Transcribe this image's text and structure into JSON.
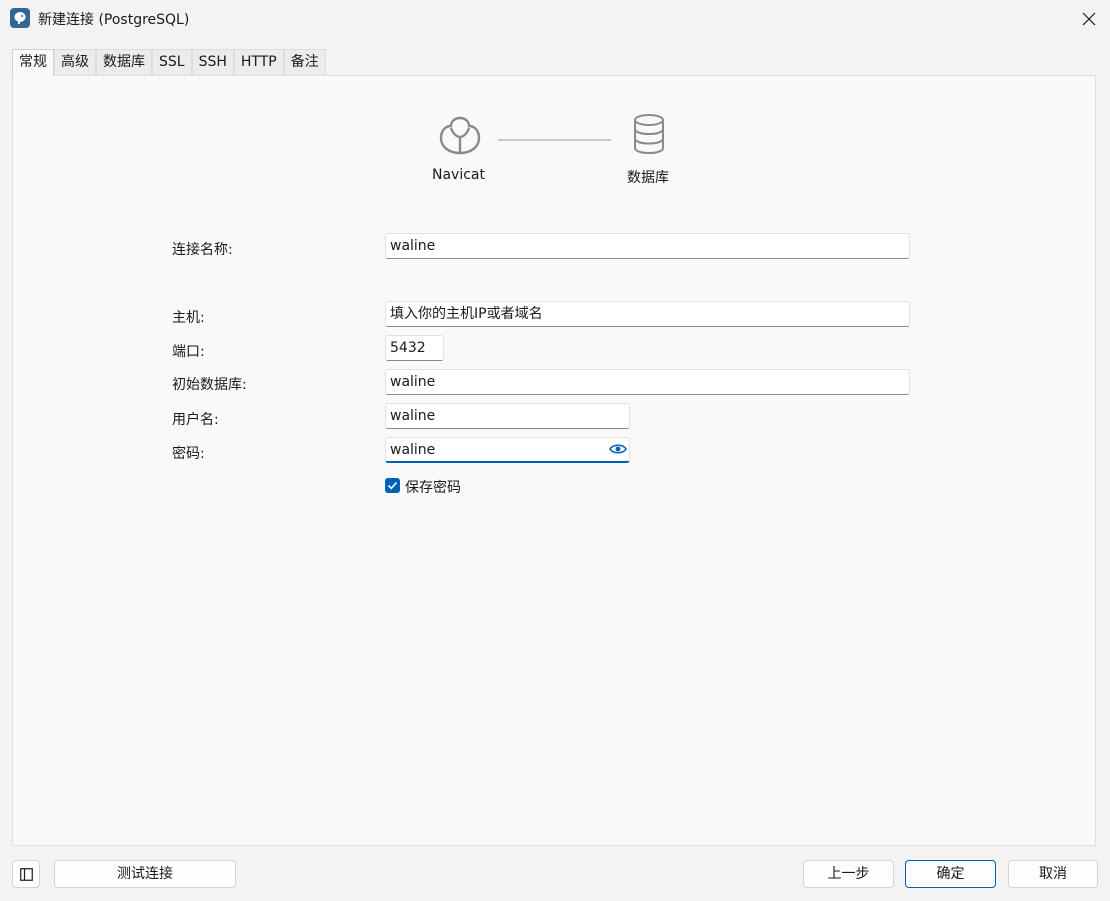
{
  "window": {
    "title": "新建连接 (PostgreSQL)",
    "app_icon": "postgresql-elephant-icon",
    "close_icon": "close-icon"
  },
  "tabs": [
    {
      "label": "常规",
      "active": true
    },
    {
      "label": "高级",
      "active": false
    },
    {
      "label": "数据库",
      "active": false
    },
    {
      "label": "SSL",
      "active": false
    },
    {
      "label": "SSH",
      "active": false
    },
    {
      "label": "HTTP",
      "active": false
    },
    {
      "label": "备注",
      "active": false
    }
  ],
  "diagram": {
    "left_label": "Navicat",
    "right_label": "数据库",
    "left_icon": "navicat-logo-icon",
    "right_icon": "database-icon"
  },
  "form": {
    "connection_name": {
      "label": "连接名称:",
      "value": "waline"
    },
    "host": {
      "label": "主机:",
      "value": "填入你的主机IP或者域名"
    },
    "port": {
      "label": "端口:",
      "value": "5432"
    },
    "initial_db": {
      "label": "初始数据库:",
      "value": "waline"
    },
    "username": {
      "label": "用户名:",
      "value": "waline"
    },
    "password": {
      "label": "密码:",
      "value": "waline"
    },
    "save_password": {
      "label": "保存密码",
      "checked": true
    }
  },
  "footer": {
    "test_connection": "测试连接",
    "previous": "上一步",
    "ok": "确定",
    "cancel": "取消"
  },
  "colors": {
    "accent": "#005fb8",
    "background": "#f3f3f3",
    "panel": "#f9f9f9"
  }
}
